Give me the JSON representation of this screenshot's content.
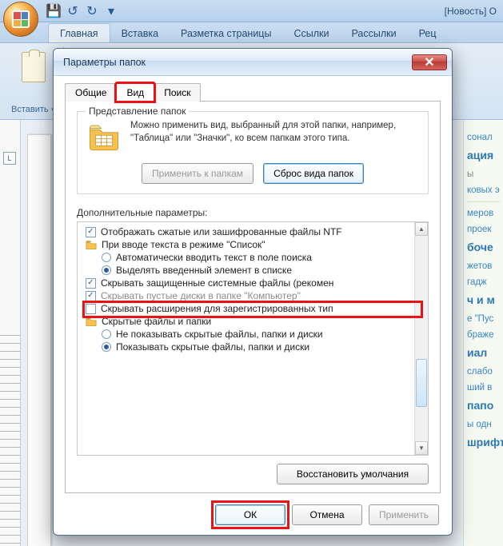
{
  "office": {
    "window_title": "[Новость] О",
    "qat": {
      "save": "💾",
      "undo": "↺",
      "redo": "↻"
    },
    "tabs": {
      "home": "Главная",
      "insert": "Вставка",
      "layout": "Разметка страницы",
      "refs": "Ссылки",
      "mail": "Рассылки",
      "review": "Рец"
    },
    "clipboard_chunk": {
      "paste": "Вставить"
    },
    "ruler_box": "L"
  },
  "rightpane": {
    "l1": "сонал",
    "h1": "ация",
    "l2": "ы",
    "l3": "ковых э",
    "l4": "меров",
    "l5": "проек",
    "h2": "боче",
    "l6": "жетов",
    "l7": "гадж",
    "h3": "ч и м",
    "l8": "е \"Пус",
    "l9": "браже",
    "h4": "иал",
    "l10": "слабо",
    "l11": "ший в",
    "h5": "папо",
    "l12": "ы одн",
    "h6": "шрифты"
  },
  "dialog": {
    "title": "Параметры папок",
    "close_text": "✕",
    "tabs": {
      "general": "Общие",
      "view": "Вид",
      "search": "Поиск"
    },
    "group": {
      "legend": "Представление папок",
      "description": "Можно применить вид, выбранный для этой папки, например, \"Таблица\" или \"Значки\", ко всем папкам этого типа.",
      "apply_btn": "Применить к папкам",
      "reset_btn": "Сброс вида папок"
    },
    "advanced": {
      "label": "Дополнительные параметры:",
      "items": [
        {
          "kind": "check",
          "checked": true,
          "indent": 0,
          "text": "Отображать сжатые или зашифрованные файлы NTF"
        },
        {
          "kind": "folder",
          "indent": 0,
          "text": "При вводе текста в режиме \"Список\""
        },
        {
          "kind": "radio",
          "checked": false,
          "indent": 1,
          "text": "Автоматически вводить текст в поле поиска"
        },
        {
          "kind": "radio",
          "checked": true,
          "indent": 1,
          "text": "Выделять введенный элемент в списке"
        },
        {
          "kind": "check",
          "checked": true,
          "indent": 0,
          "text": "Скрывать защищенные системные файлы (рекомен"
        },
        {
          "kind": "check",
          "checked": true,
          "indent": 0,
          "dim": true,
          "text": "Скрывать пустые диски в папке \"Компьютер\""
        },
        {
          "kind": "check",
          "checked": false,
          "indent": 0,
          "text": "Скрывать расширения для зарегистрированных тип",
          "highlight": true
        },
        {
          "kind": "folder",
          "indent": 0,
          "text": "Скрытые файлы и папки"
        },
        {
          "kind": "radio",
          "checked": false,
          "indent": 1,
          "text": "Не показывать скрытые файлы, папки и диски"
        },
        {
          "kind": "radio",
          "checked": true,
          "indent": 1,
          "text": "Показывать скрытые файлы, папки и диски"
        }
      ],
      "restore_btn": "Восстановить умолчания"
    },
    "buttons": {
      "ok": "ОК",
      "cancel": "Отмена",
      "apply": "Применить"
    }
  }
}
